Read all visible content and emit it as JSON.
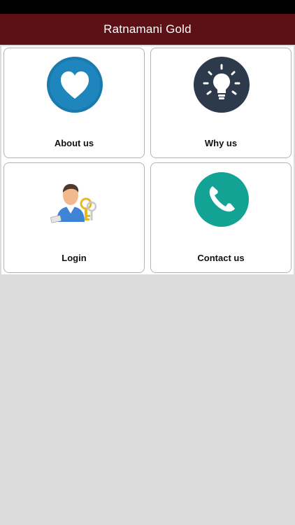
{
  "header": {
    "title": "Ratnamani Gold"
  },
  "tiles": [
    {
      "label": "About us",
      "icon": "heart-icon",
      "color": "#1a7aad"
    },
    {
      "label": "Why us",
      "icon": "lightbulb-icon",
      "color": "#2d3a4c"
    },
    {
      "label": "Login",
      "icon": "user-key-icon",
      "color": "#e8b820"
    },
    {
      "label": "Contact us",
      "icon": "phone-icon",
      "color": "#12a394"
    }
  ],
  "colors": {
    "nav_bar": "#5d1016",
    "background": "#dcdcdc"
  }
}
